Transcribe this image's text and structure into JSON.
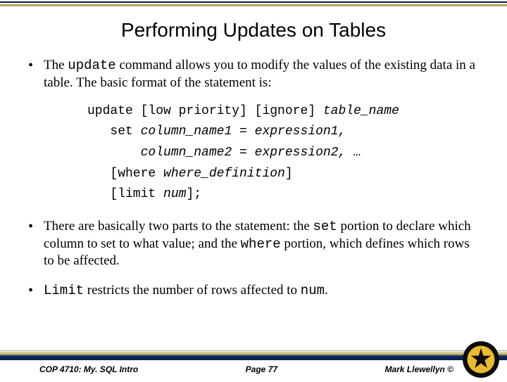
{
  "title": "Performing Updates on Tables",
  "bullets": {
    "b1_pre": "The ",
    "b1_code": "update",
    "b1_post": " command allows you to modify the values of the existing data in a table.  The basic format of the statement is:",
    "b2_p1": "There are basically two parts to the statement: the ",
    "b2_c1": "set",
    "b2_p2": " portion to declare which column to set to what value; and the ",
    "b2_c2": "where",
    "b2_p3": " portion, which defines which rows to be affected.",
    "b3_c1": "Limit",
    "b3_p1": " restricts the number of rows affected to ",
    "b3_c2": "num",
    "b3_p2": "."
  },
  "code": {
    "l1a": "update [low priority] [ignore] ",
    "l1b": "table_name",
    "l2a": "   set ",
    "l2b": "column_name1 = expression1,",
    "l3a": "       ",
    "l3b": "column_name2 = expression2, …",
    "l4a": "   [where ",
    "l4b": "where_definition",
    "l4c": "]",
    "l5a": "   [limit ",
    "l5b": "num",
    "l5c": "];"
  },
  "footer": {
    "course": "COP 4710: My. SQL Intro",
    "page": "Page 77",
    "author": "Mark Llewellyn ©"
  }
}
